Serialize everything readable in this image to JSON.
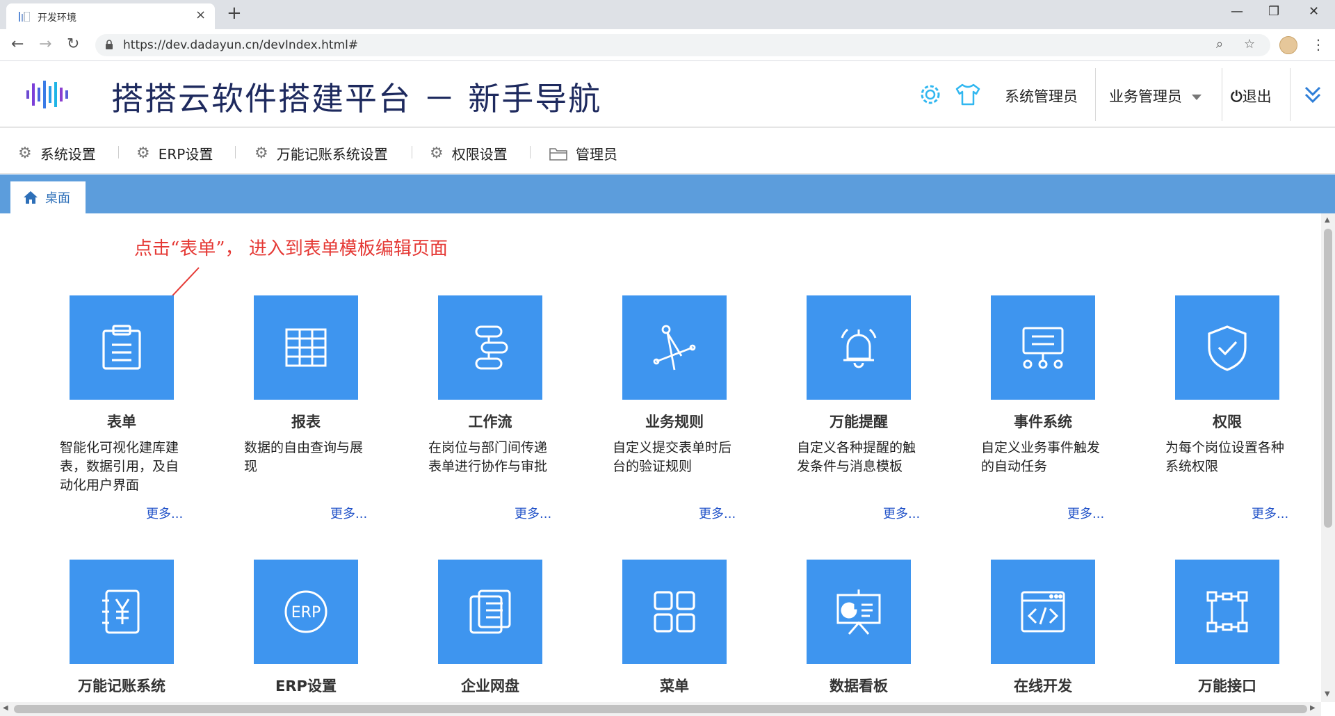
{
  "browser": {
    "tab_title": "开发环境",
    "url": "https://dev.dadayun.cn/devIndex.html#"
  },
  "header": {
    "title": "搭搭云软件搭建平台 － 新手导航",
    "system_admin": "系统管理员",
    "business_admin": "业务管理员",
    "logout": "退出"
  },
  "menu": {
    "items": [
      {
        "label": "系统设置",
        "icon": "gear-icon"
      },
      {
        "label": "ERP设置",
        "icon": "gear-icon"
      },
      {
        "label": "万能记账系统设置",
        "icon": "gear-icon"
      },
      {
        "label": "权限设置",
        "icon": "gear-icon"
      },
      {
        "label": "管理员",
        "icon": "folder-icon"
      }
    ]
  },
  "tabs": {
    "desktop": "桌面"
  },
  "hint": "点击“表单”， 进入到表单模板编辑页面",
  "more_label": "更多...",
  "cards_row1": [
    {
      "title": "表单",
      "desc": "智能化可视化建库建表，数据引用，及自动化用户界面",
      "icon": "clipboard-icon"
    },
    {
      "title": "报表",
      "desc": "数据的自由查询与展现",
      "icon": "table-icon"
    },
    {
      "title": "工作流",
      "desc": "在岗位与部门间传递表单进行协作与审批",
      "icon": "workflow-icon"
    },
    {
      "title": "业务规则",
      "desc": "自定义提交表单时后台的验证规则",
      "icon": "compass-icon"
    },
    {
      "title": "万能提醒",
      "desc": "自定义各种提醒的触发条件与消息模板",
      "icon": "bell-icon"
    },
    {
      "title": "事件系统",
      "desc": "自定义业务事件触发的自动任务",
      "icon": "event-icon"
    },
    {
      "title": "权限",
      "desc": "为每个岗位设置各种系统权限",
      "icon": "shield-icon"
    }
  ],
  "cards_row2": [
    {
      "title": "万能记账系统",
      "icon": "ledger-icon"
    },
    {
      "title": "ERP设置",
      "icon": "erp-icon"
    },
    {
      "title": "企业网盘",
      "icon": "netdisk-icon"
    },
    {
      "title": "菜单",
      "icon": "menu-grid-icon"
    },
    {
      "title": "数据看板",
      "icon": "dashboard-icon"
    },
    {
      "title": "在线开发",
      "icon": "code-icon"
    },
    {
      "title": "万能接口",
      "icon": "interface-icon"
    }
  ],
  "colors": {
    "tile": "#3e95ef",
    "tab_strip": "#5c9ddc",
    "hint": "#e53935",
    "title": "#1e2a5e",
    "more_link": "#2454c9"
  }
}
